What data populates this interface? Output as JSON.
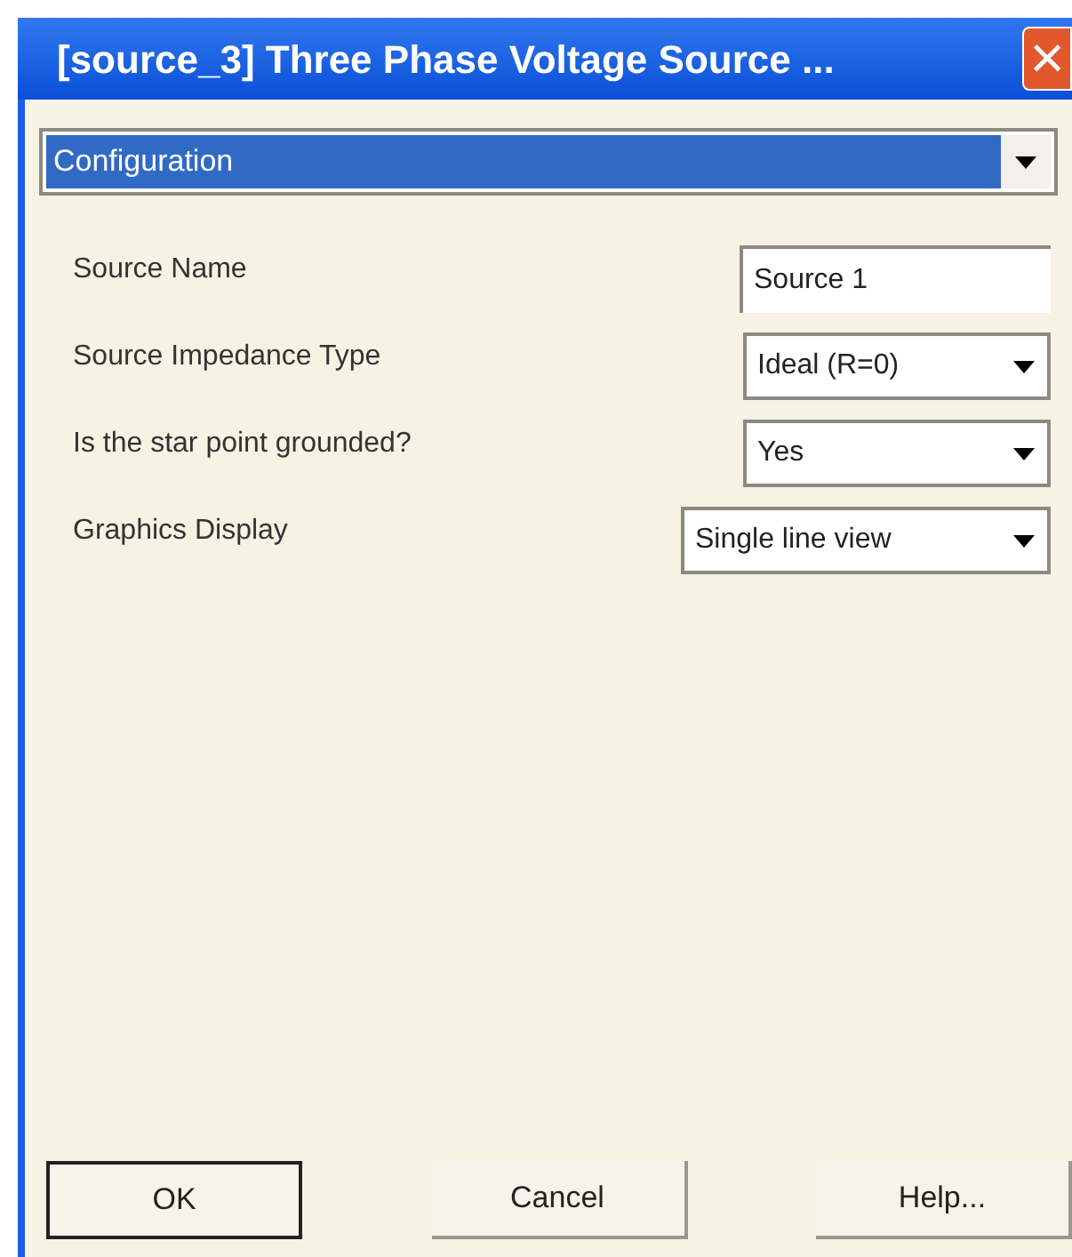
{
  "window": {
    "title": "[source_3] Three Phase Voltage Source ...",
    "close": "×"
  },
  "section": {
    "value": "Configuration",
    "selected": true
  },
  "fields": [
    {
      "label": "Source Name",
      "kind": "text",
      "value": "Source 1"
    },
    {
      "label": "Source Impedance Type",
      "kind": "dropdown",
      "value": "Ideal (R=0)"
    },
    {
      "label": "Is the star point grounded?",
      "kind": "dropdown",
      "value": "Yes"
    },
    {
      "label": "Graphics Display",
      "kind": "dropdown",
      "value": "Single line view"
    }
  ],
  "buttons": [
    {
      "label": "OK",
      "default": true
    },
    {
      "label": "Cancel",
      "default": false
    },
    {
      "label": "Help...",
      "default": false
    }
  ]
}
